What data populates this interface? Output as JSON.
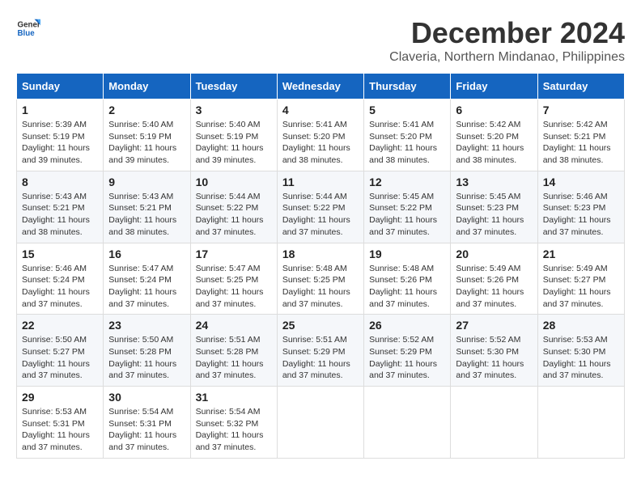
{
  "logo": {
    "line1": "General",
    "line2": "Blue"
  },
  "title": "December 2024",
  "location": "Claveria, Northern Mindanao, Philippines",
  "weekdays": [
    "Sunday",
    "Monday",
    "Tuesday",
    "Wednesday",
    "Thursday",
    "Friday",
    "Saturday"
  ],
  "weeks": [
    [
      {
        "day": "1",
        "info": "Sunrise: 5:39 AM\nSunset: 5:19 PM\nDaylight: 11 hours\nand 39 minutes."
      },
      {
        "day": "2",
        "info": "Sunrise: 5:40 AM\nSunset: 5:19 PM\nDaylight: 11 hours\nand 39 minutes."
      },
      {
        "day": "3",
        "info": "Sunrise: 5:40 AM\nSunset: 5:19 PM\nDaylight: 11 hours\nand 39 minutes."
      },
      {
        "day": "4",
        "info": "Sunrise: 5:41 AM\nSunset: 5:20 PM\nDaylight: 11 hours\nand 38 minutes."
      },
      {
        "day": "5",
        "info": "Sunrise: 5:41 AM\nSunset: 5:20 PM\nDaylight: 11 hours\nand 38 minutes."
      },
      {
        "day": "6",
        "info": "Sunrise: 5:42 AM\nSunset: 5:20 PM\nDaylight: 11 hours\nand 38 minutes."
      },
      {
        "day": "7",
        "info": "Sunrise: 5:42 AM\nSunset: 5:21 PM\nDaylight: 11 hours\nand 38 minutes."
      }
    ],
    [
      {
        "day": "8",
        "info": "Sunrise: 5:43 AM\nSunset: 5:21 PM\nDaylight: 11 hours\nand 38 minutes."
      },
      {
        "day": "9",
        "info": "Sunrise: 5:43 AM\nSunset: 5:21 PM\nDaylight: 11 hours\nand 38 minutes."
      },
      {
        "day": "10",
        "info": "Sunrise: 5:44 AM\nSunset: 5:22 PM\nDaylight: 11 hours\nand 37 minutes."
      },
      {
        "day": "11",
        "info": "Sunrise: 5:44 AM\nSunset: 5:22 PM\nDaylight: 11 hours\nand 37 minutes."
      },
      {
        "day": "12",
        "info": "Sunrise: 5:45 AM\nSunset: 5:22 PM\nDaylight: 11 hours\nand 37 minutes."
      },
      {
        "day": "13",
        "info": "Sunrise: 5:45 AM\nSunset: 5:23 PM\nDaylight: 11 hours\nand 37 minutes."
      },
      {
        "day": "14",
        "info": "Sunrise: 5:46 AM\nSunset: 5:23 PM\nDaylight: 11 hours\nand 37 minutes."
      }
    ],
    [
      {
        "day": "15",
        "info": "Sunrise: 5:46 AM\nSunset: 5:24 PM\nDaylight: 11 hours\nand 37 minutes."
      },
      {
        "day": "16",
        "info": "Sunrise: 5:47 AM\nSunset: 5:24 PM\nDaylight: 11 hours\nand 37 minutes."
      },
      {
        "day": "17",
        "info": "Sunrise: 5:47 AM\nSunset: 5:25 PM\nDaylight: 11 hours\nand 37 minutes."
      },
      {
        "day": "18",
        "info": "Sunrise: 5:48 AM\nSunset: 5:25 PM\nDaylight: 11 hours\nand 37 minutes."
      },
      {
        "day": "19",
        "info": "Sunrise: 5:48 AM\nSunset: 5:26 PM\nDaylight: 11 hours\nand 37 minutes."
      },
      {
        "day": "20",
        "info": "Sunrise: 5:49 AM\nSunset: 5:26 PM\nDaylight: 11 hours\nand 37 minutes."
      },
      {
        "day": "21",
        "info": "Sunrise: 5:49 AM\nSunset: 5:27 PM\nDaylight: 11 hours\nand 37 minutes."
      }
    ],
    [
      {
        "day": "22",
        "info": "Sunrise: 5:50 AM\nSunset: 5:27 PM\nDaylight: 11 hours\nand 37 minutes."
      },
      {
        "day": "23",
        "info": "Sunrise: 5:50 AM\nSunset: 5:28 PM\nDaylight: 11 hours\nand 37 minutes."
      },
      {
        "day": "24",
        "info": "Sunrise: 5:51 AM\nSunset: 5:28 PM\nDaylight: 11 hours\nand 37 minutes."
      },
      {
        "day": "25",
        "info": "Sunrise: 5:51 AM\nSunset: 5:29 PM\nDaylight: 11 hours\nand 37 minutes."
      },
      {
        "day": "26",
        "info": "Sunrise: 5:52 AM\nSunset: 5:29 PM\nDaylight: 11 hours\nand 37 minutes."
      },
      {
        "day": "27",
        "info": "Sunrise: 5:52 AM\nSunset: 5:30 PM\nDaylight: 11 hours\nand 37 minutes."
      },
      {
        "day": "28",
        "info": "Sunrise: 5:53 AM\nSunset: 5:30 PM\nDaylight: 11 hours\nand 37 minutes."
      }
    ],
    [
      {
        "day": "29",
        "info": "Sunrise: 5:53 AM\nSunset: 5:31 PM\nDaylight: 11 hours\nand 37 minutes."
      },
      {
        "day": "30",
        "info": "Sunrise: 5:54 AM\nSunset: 5:31 PM\nDaylight: 11 hours\nand 37 minutes."
      },
      {
        "day": "31",
        "info": "Sunrise: 5:54 AM\nSunset: 5:32 PM\nDaylight: 11 hours\nand 37 minutes."
      },
      null,
      null,
      null,
      null
    ]
  ]
}
